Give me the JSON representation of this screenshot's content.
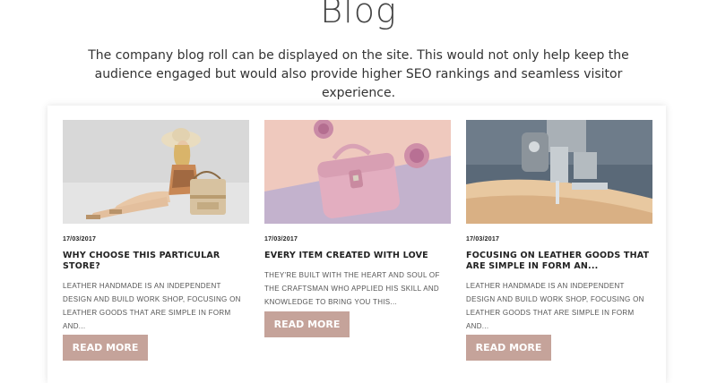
{
  "page": {
    "title": "Blog",
    "intro": "The company blog roll can be displayed on the site. This would not only help keep the audience engaged but would also provide higher SEO rankings and seamless visitor experience."
  },
  "posts": [
    {
      "date": "17/03/2017",
      "title": "Why choose this particular store?",
      "excerpt": "Leather handmade is an independent design and build work shop, focusing on leather goods that are simple in form and...",
      "button": "Read more",
      "image": "woman-sitting-with-straw-hat-and-bag-photo"
    },
    {
      "date": "17/03/2017",
      "title": "Every item created with love",
      "excerpt": "They're built with the heart and soul of the craftsman who applied his skill and knowledge to bring you this...",
      "button": "Read more",
      "image": "pink-leather-handbag-photo"
    },
    {
      "date": "17/03/2017",
      "title": "Focusing on leather goods that are simple in form an...",
      "excerpt": "Leather handmade is an independent design and build work shop, focusing on leather goods that are simple in form and...",
      "button": "Read more",
      "image": "sewing-machine-leather-photo"
    }
  ],
  "colors": {
    "accent": "#c5a39a",
    "heading": "#444444",
    "text": "#333333"
  }
}
